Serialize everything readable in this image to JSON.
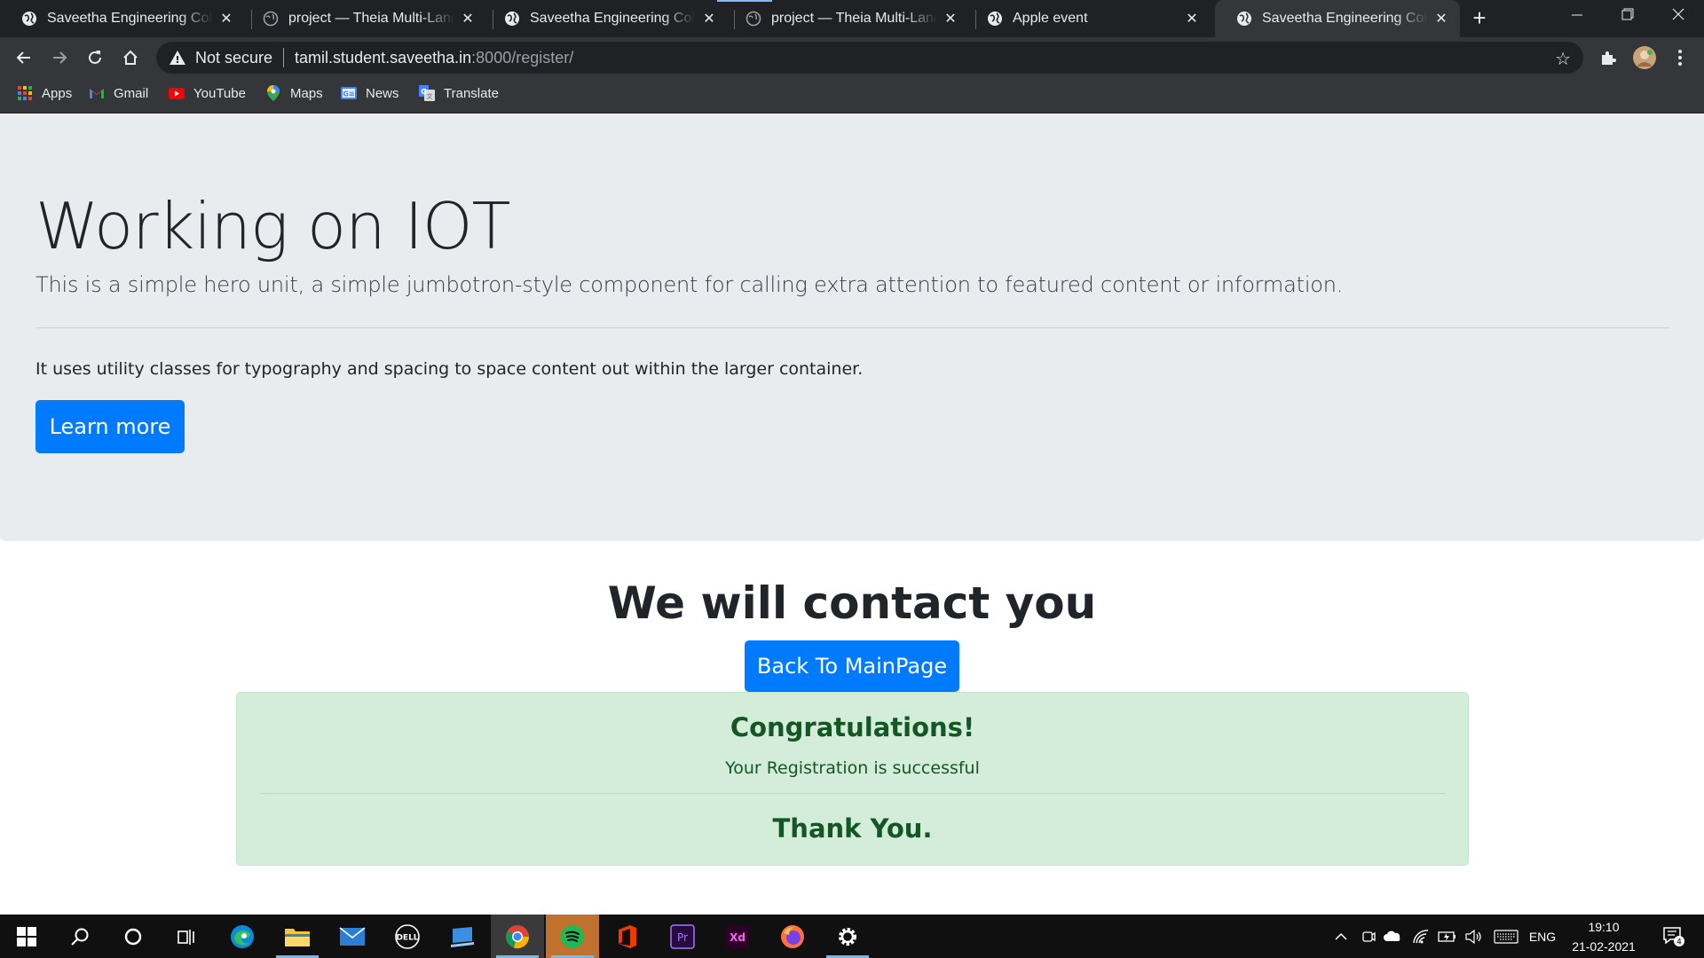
{
  "browser": {
    "tabs": [
      {
        "title": "Saveetha Engineering College"
      },
      {
        "title": "project — Theia Multi-Language"
      },
      {
        "title": "Saveetha Engineering College"
      },
      {
        "title": "project — Theia Multi-Language"
      },
      {
        "title": "Apple event"
      },
      {
        "title": "Saveetha Engineering College"
      }
    ],
    "address": {
      "security_label": "Not secure",
      "host": "tamil.student.saveetha.in",
      "path": ":8000/register/"
    },
    "bookmarks": [
      {
        "label": "Apps",
        "icon": "apps-grid-icon"
      },
      {
        "label": "Gmail",
        "icon": "gmail-icon"
      },
      {
        "label": "YouTube",
        "icon": "youtube-icon"
      },
      {
        "label": "Maps",
        "icon": "maps-icon"
      },
      {
        "label": "News",
        "icon": "news-icon"
      },
      {
        "label": "Translate",
        "icon": "translate-icon"
      }
    ]
  },
  "page": {
    "jumbotron": {
      "heading": "Working on IOT",
      "lead": "This is a simple hero unit, a simple jumbotron-style component for calling extra attention to featured content or information.",
      "body": "It uses utility classes for typography and spacing to space content out within the larger container.",
      "button": "Learn more"
    },
    "contact_heading": "We will contact you",
    "back_button": "Back To MainPage",
    "alert": {
      "heading": "Congratulations!",
      "message": "Your Registration is successful",
      "footer": "Thank You."
    }
  },
  "taskbar": {
    "language": "ENG",
    "time": "19:10",
    "date": "21-02-2021",
    "notification_count": "4"
  },
  "colors": {
    "primary": "#007bff",
    "jumbotron_bg": "#e9ecef",
    "alert_bg": "#d4edda",
    "alert_text": "#155724",
    "chrome_dark": "#202124",
    "chrome_toolbar": "#35363a"
  }
}
